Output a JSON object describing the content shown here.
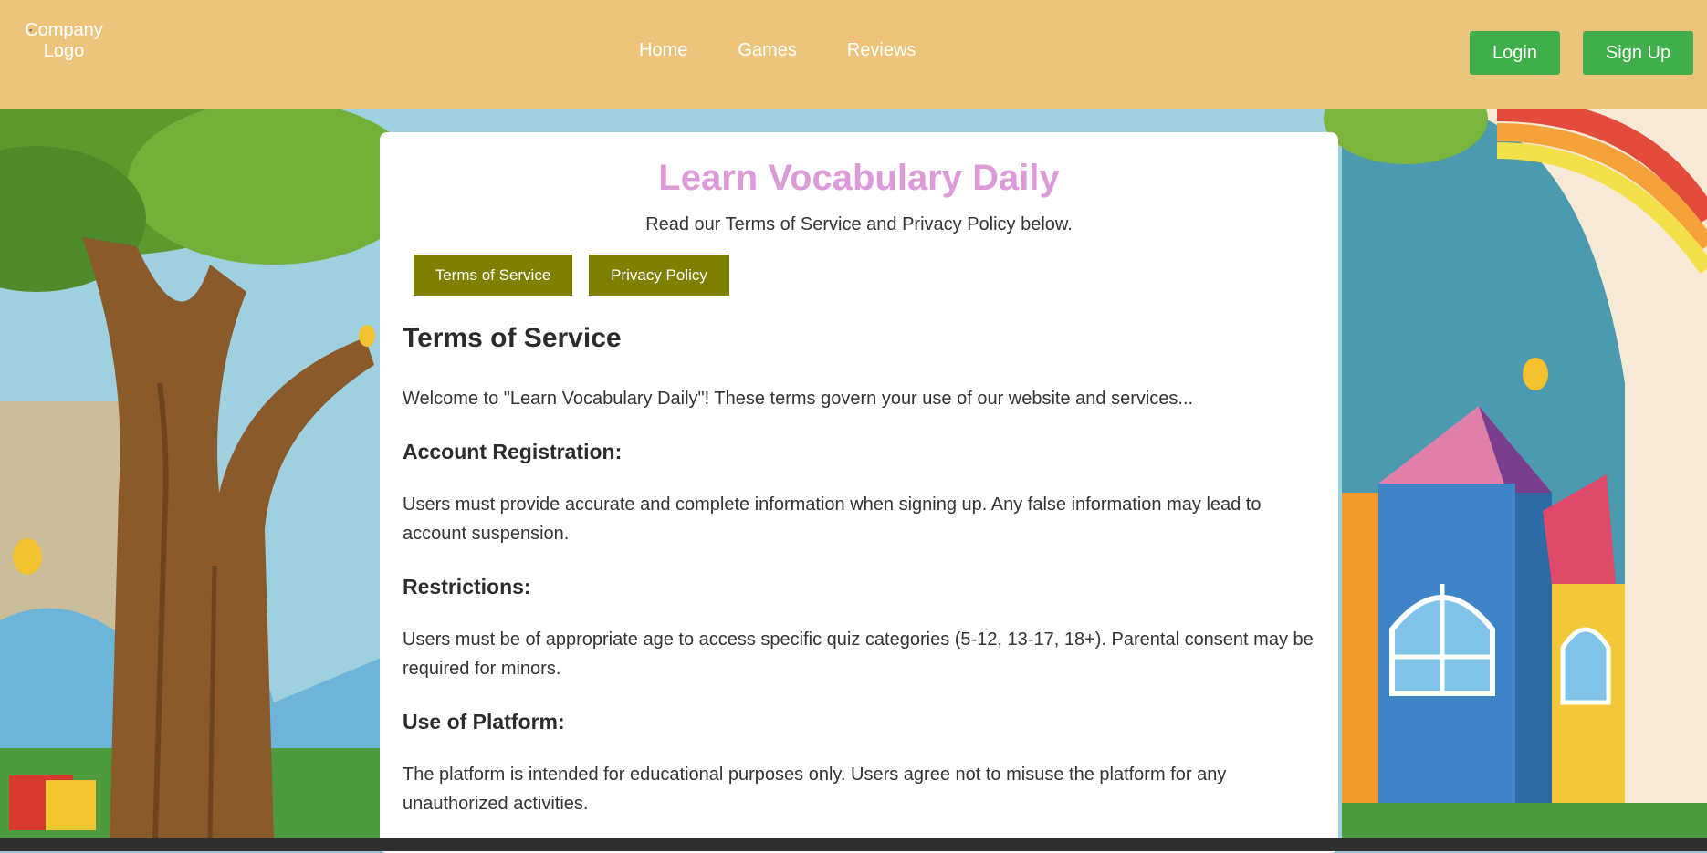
{
  "header": {
    "logo_text": "Company Logo",
    "nav": [
      "Home",
      "Games",
      "Reviews"
    ],
    "login_label": "Login",
    "signup_label": "Sign Up"
  },
  "card": {
    "title": "Learn Vocabulary Daily",
    "subtitle": "Read our Terms of Service and Privacy Policy below.",
    "tabs": [
      "Terms of Service",
      "Privacy Policy"
    ],
    "section_title": "Terms of Service",
    "intro": "Welcome to \"Learn Vocabulary Daily\"! These terms govern your use of our website and services...",
    "sections": [
      {
        "heading": "Account Registration:",
        "text": "Users must provide accurate and complete information when signing up. Any false information may lead to account suspension."
      },
      {
        "heading": "Restrictions:",
        "text": "Users must be of appropriate age to access specific quiz categories (5-12, 13-17, 18+). Parental consent may be required for minors."
      },
      {
        "heading": "Use of Platform:",
        "text": "The platform is intended for educational purposes only. Users agree not to misuse the platform for any unauthorized activities."
      }
    ]
  },
  "colors": {
    "header_bg": "#ecc47c",
    "button_green": "#3fae4b",
    "tab_olive": "#7f7f00",
    "title_pink": "#dd9ad9"
  }
}
